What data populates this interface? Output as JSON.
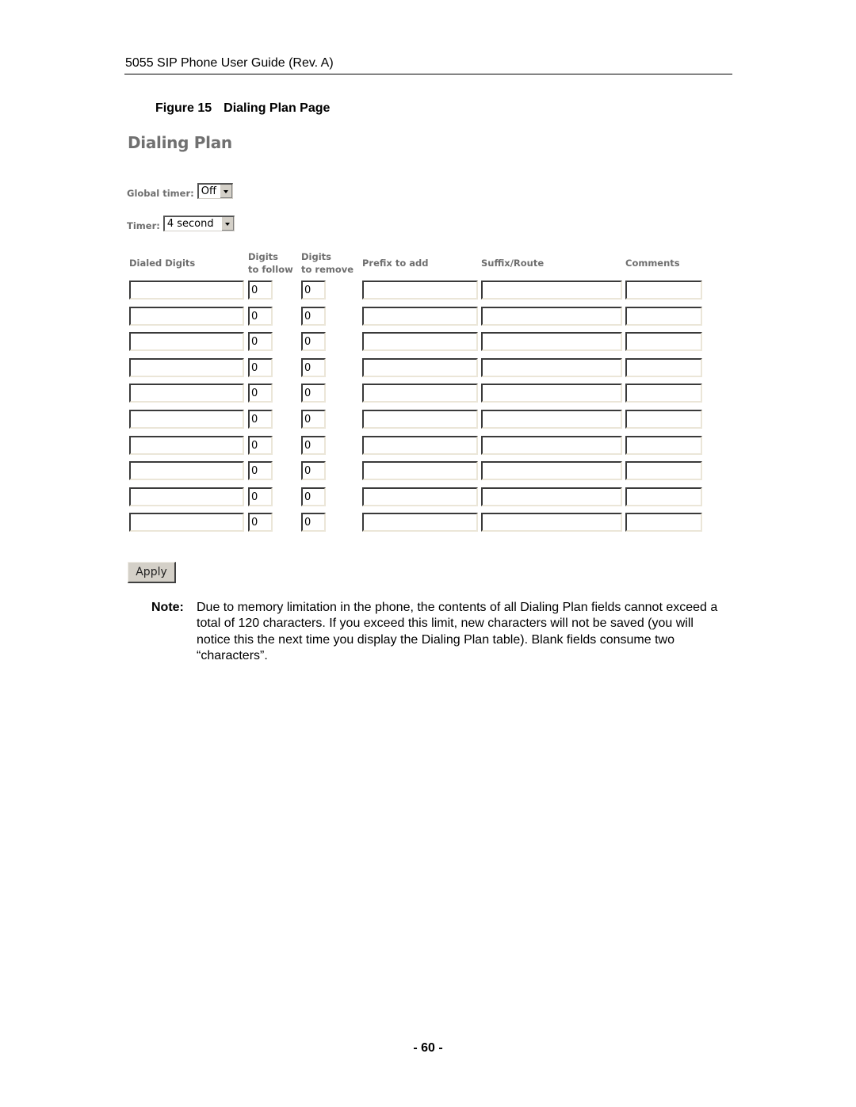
{
  "document": {
    "running_header": "5055 SIP Phone User Guide (Rev. A)",
    "figure_number": "Figure 15",
    "figure_title": "Dialing Plan Page",
    "page_number": "- 60 -"
  },
  "screen": {
    "title": "Dialing Plan",
    "global_timer": {
      "label": "Global timer:",
      "value": "Off"
    },
    "timer": {
      "label": "Timer:",
      "value": "4 second"
    },
    "table": {
      "columns": [
        {
          "key": "dialed_digits",
          "line1": "Dialed Digits",
          "line2": ""
        },
        {
          "key": "digits_to_follow",
          "line1": "Digits",
          "line2": "to follow"
        },
        {
          "key": "digits_to_remove",
          "line1": "Digits",
          "line2": "to remove"
        },
        {
          "key": "prefix_to_add",
          "line1": "Prefix to add",
          "line2": ""
        },
        {
          "key": "suffix_route",
          "line1": "Suffix/Route",
          "line2": ""
        },
        {
          "key": "comments",
          "line1": "Comments",
          "line2": ""
        }
      ],
      "rows": [
        {
          "dialed_digits": "",
          "digits_to_follow": "0",
          "digits_to_remove": "0",
          "prefix_to_add": "",
          "suffix_route": "",
          "comments": ""
        },
        {
          "dialed_digits": "",
          "digits_to_follow": "0",
          "digits_to_remove": "0",
          "prefix_to_add": "",
          "suffix_route": "",
          "comments": ""
        },
        {
          "dialed_digits": "",
          "digits_to_follow": "0",
          "digits_to_remove": "0",
          "prefix_to_add": "",
          "suffix_route": "",
          "comments": ""
        },
        {
          "dialed_digits": "",
          "digits_to_follow": "0",
          "digits_to_remove": "0",
          "prefix_to_add": "",
          "suffix_route": "",
          "comments": ""
        },
        {
          "dialed_digits": "",
          "digits_to_follow": "0",
          "digits_to_remove": "0",
          "prefix_to_add": "",
          "suffix_route": "",
          "comments": ""
        },
        {
          "dialed_digits": "",
          "digits_to_follow": "0",
          "digits_to_remove": "0",
          "prefix_to_add": "",
          "suffix_route": "",
          "comments": ""
        },
        {
          "dialed_digits": "",
          "digits_to_follow": "0",
          "digits_to_remove": "0",
          "prefix_to_add": "",
          "suffix_route": "",
          "comments": ""
        },
        {
          "dialed_digits": "",
          "digits_to_follow": "0",
          "digits_to_remove": "0",
          "prefix_to_add": "",
          "suffix_route": "",
          "comments": ""
        },
        {
          "dialed_digits": "",
          "digits_to_follow": "0",
          "digits_to_remove": "0",
          "prefix_to_add": "",
          "suffix_route": "",
          "comments": ""
        },
        {
          "dialed_digits": "",
          "digits_to_follow": "0",
          "digits_to_remove": "0",
          "prefix_to_add": "",
          "suffix_route": "",
          "comments": ""
        }
      ]
    },
    "apply_label": "Apply"
  },
  "note": {
    "label": "Note:",
    "text": "Due to memory limitation in the phone, the contents of all Dialing Plan fields cannot exceed a total of 120 characters. If you exceed this limit, new characters will not be saved (you will notice this the next time you display the Dialing Plan table). Blank fields consume two “characters”."
  }
}
